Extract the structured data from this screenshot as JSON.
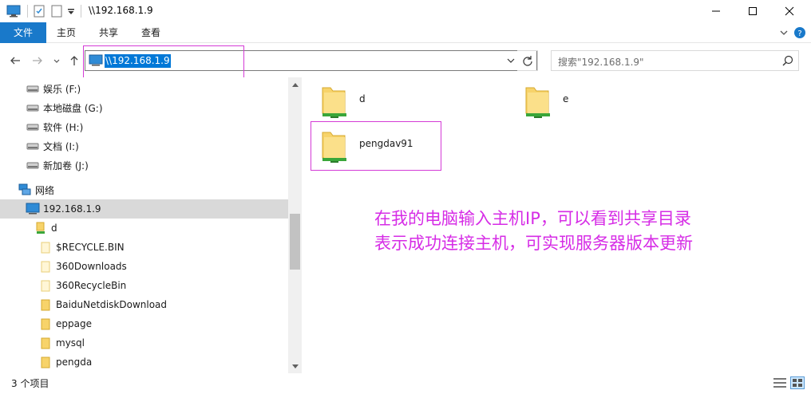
{
  "window": {
    "title": "\\\\192.168.1.9"
  },
  "ribbon": {
    "tabs": [
      {
        "label": "文件"
      },
      {
        "label": "主页"
      },
      {
        "label": "共享"
      },
      {
        "label": "查看"
      }
    ]
  },
  "address": {
    "path": "\\\\192.168.1.9",
    "search_placeholder": "搜索\"192.168.1.9\""
  },
  "nav": {
    "drives": [
      {
        "label": "娱乐 (F:)"
      },
      {
        "label": "本地磁盘 (G:)"
      },
      {
        "label": "软件 (H:)"
      },
      {
        "label": "文档 (I:)"
      },
      {
        "label": "新加卷 (J:)"
      }
    ],
    "network_label": "网络",
    "host_label": "192.168.1.9",
    "share_label": "d",
    "folders": [
      {
        "label": "$RECYCLE.BIN"
      },
      {
        "label": "360Downloads"
      },
      {
        "label": "360RecycleBin"
      },
      {
        "label": "BaiduNetdiskDownload"
      },
      {
        "label": "eppage"
      },
      {
        "label": "mysql"
      },
      {
        "label": "pengda"
      }
    ]
  },
  "content": {
    "items": [
      {
        "name": "d"
      },
      {
        "name": "e"
      },
      {
        "name": "pengdav91"
      }
    ]
  },
  "annotation": {
    "line1": "在我的电脑输入主机IP，可以看到共享目录",
    "line2": "表示成功连接主机，可实现服务器版本更新",
    "color": "#d62ce6"
  },
  "status": {
    "item_count": "3 个项目"
  }
}
